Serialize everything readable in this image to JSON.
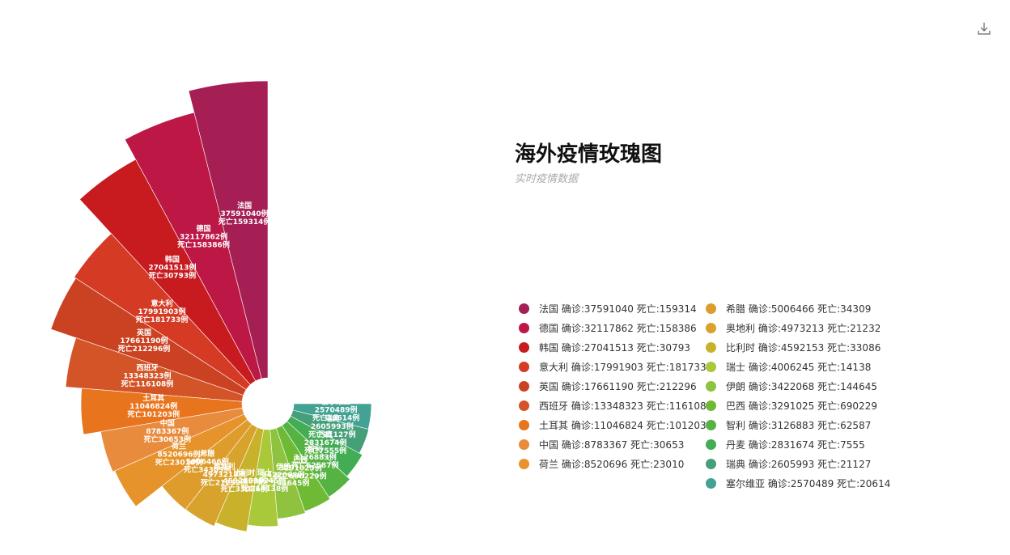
{
  "title": "海外疫情玫瑰图",
  "subtitle": "实时疫情数据",
  "toolbar": {
    "download_icon": "download-icon"
  },
  "chart_data": {
    "type": "nightingale-rose",
    "title": "海外疫情玫瑰图",
    "subtitle": "实时疫情数据",
    "legend_placement": "right",
    "colors": [
      "#a51f55",
      "#bc1745",
      "#c71b1f",
      "#d53a25",
      "#cb4222",
      "#d35426",
      "#e8741d",
      "#e88b3c",
      "#e5932a",
      "#dd9c2c",
      "#d8a32d",
      "#c8b22c",
      "#a9c83a",
      "#8fc33f",
      "#6fba35",
      "#56b242",
      "#43ad55",
      "#45a07a",
      "#43a293"
    ],
    "series": [
      {
        "name": "法国",
        "confirmed": 37591040,
        "deaths": 159314
      },
      {
        "name": "德国",
        "confirmed": 32117862,
        "deaths": 158386
      },
      {
        "name": "韩国",
        "confirmed": 27041513,
        "deaths": 30793
      },
      {
        "name": "意大利",
        "confirmed": 17991903,
        "deaths": 181733
      },
      {
        "name": "英国",
        "confirmed": 17661190,
        "deaths": 212296
      },
      {
        "name": "西班牙",
        "confirmed": 13348323,
        "deaths": 116108
      },
      {
        "name": "土耳其",
        "confirmed": 11046824,
        "deaths": 101203
      },
      {
        "name": "中国",
        "confirmed": 8783367,
        "deaths": 30653
      },
      {
        "name": "荷兰",
        "confirmed": 8520696,
        "deaths": 23010
      },
      {
        "name": "希腊",
        "confirmed": 5006466,
        "deaths": 34309
      },
      {
        "name": "奥地利",
        "confirmed": 4973213,
        "deaths": 21232
      },
      {
        "name": "比利时",
        "confirmed": 4592153,
        "deaths": 33086
      },
      {
        "name": "瑞士",
        "confirmed": 4006245,
        "deaths": 14138
      },
      {
        "name": "伊朗",
        "confirmed": 3422068,
        "deaths": 144645
      },
      {
        "name": "巴西",
        "confirmed": 3291025,
        "deaths": 690229
      },
      {
        "name": "智利",
        "confirmed": 3126883,
        "deaths": 62587
      },
      {
        "name": "丹麦",
        "confirmed": 2831674,
        "deaths": 7555
      },
      {
        "name": "瑞典",
        "confirmed": 2605993,
        "deaths": 21127
      },
      {
        "name": "塞尔维亚",
        "confirmed": 2570489,
        "deaths": 20614
      }
    ],
    "label_format": {
      "confirmed_prefix": "确诊:",
      "deaths_prefix": "死亡:",
      "unit": "例",
      "death_label_prefix": "死亡"
    }
  }
}
